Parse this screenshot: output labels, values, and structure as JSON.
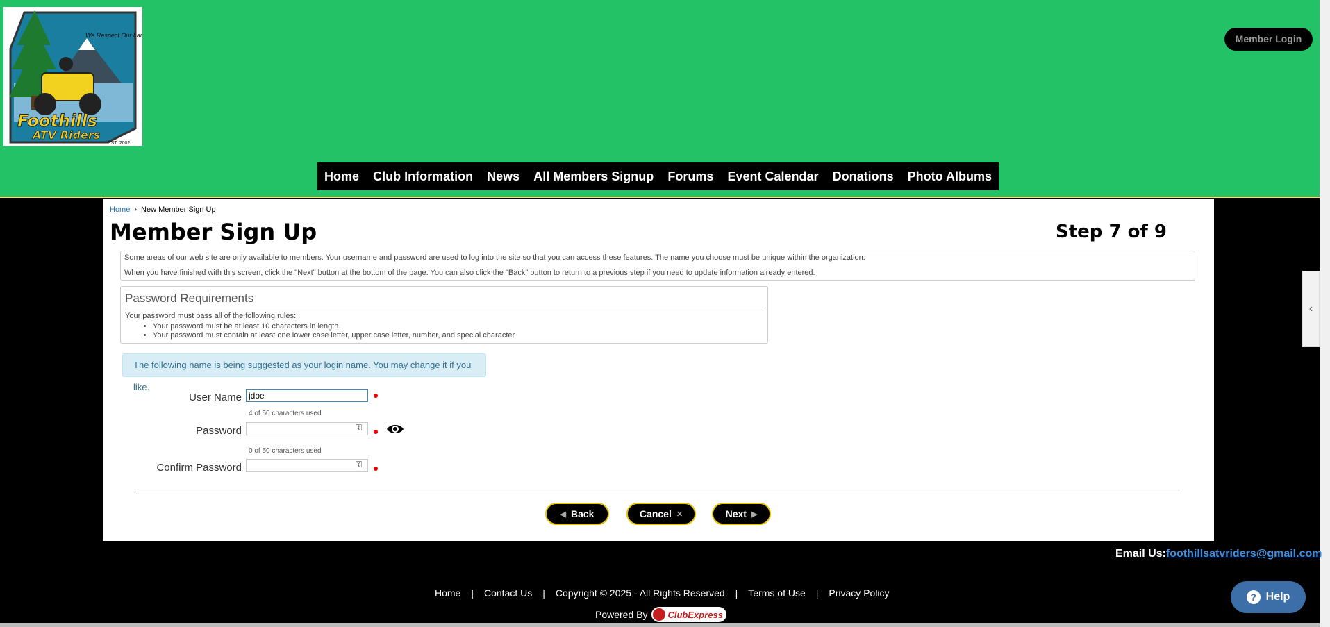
{
  "header": {
    "logo": {
      "tagline": "We Respect Our Landowners",
      "name_line1": "Foothills",
      "name_line2": "ATV Riders",
      "est": "EST. 2002"
    },
    "member_login": "Member Login",
    "nav": [
      "Home",
      "Club Information",
      "News",
      "All Members Signup",
      "Forums",
      "Event Calendar",
      "Donations",
      "Photo Albums"
    ],
    "colors": {
      "header_bg": "#23c266",
      "accent_border": "#e6c200"
    }
  },
  "breadcrumb": {
    "home": "Home",
    "separator": "›",
    "current": "New Member Sign Up"
  },
  "main": {
    "title": "Member Sign Up",
    "step": "Step 7 of 9",
    "info_p1": "Some areas of our web site are only available to members. Your username and password are used to log into the site so that you can access these features. The name you choose must be unique within the organization.",
    "info_p2": "When you have finished with this screen, click the \"Next\" button at the bottom of the page. You can also click the \"Back\" button to return to a previous step if you need to update information already entered.",
    "pw_requirements": {
      "title": "Password Requirements",
      "intro": "Your password must pass all of the following rules:",
      "rules": [
        "Your password must be at least 10 characters in length.",
        "Your password must contain at least one lower case letter, upper case letter, number, and special character."
      ]
    },
    "suggestion": "The following name is being suggested as your login name. You may change it if you like.",
    "form": {
      "username_label": "User Name",
      "username_value": "jdoe",
      "username_count": "4 of 50 characters used",
      "password_label": "Password",
      "password_value": "",
      "password_count": "0 of 50 characters used",
      "confirm_label": "Confirm Password",
      "confirm_value": ""
    },
    "buttons": {
      "back": "Back",
      "cancel": "Cancel",
      "next": "Next"
    }
  },
  "footer": {
    "email_label": "Email Us:",
    "email": "foothillsatvriders@gmail.com",
    "links": [
      "Home",
      "Contact Us",
      "Copyright © 2025 - All Rights Reserved",
      "Terms of Use",
      "Privacy Policy"
    ],
    "separator": "|",
    "powered_by": "Powered By",
    "powered_brand_club": "Club",
    "powered_brand_express": "Express",
    "help": "Help"
  }
}
